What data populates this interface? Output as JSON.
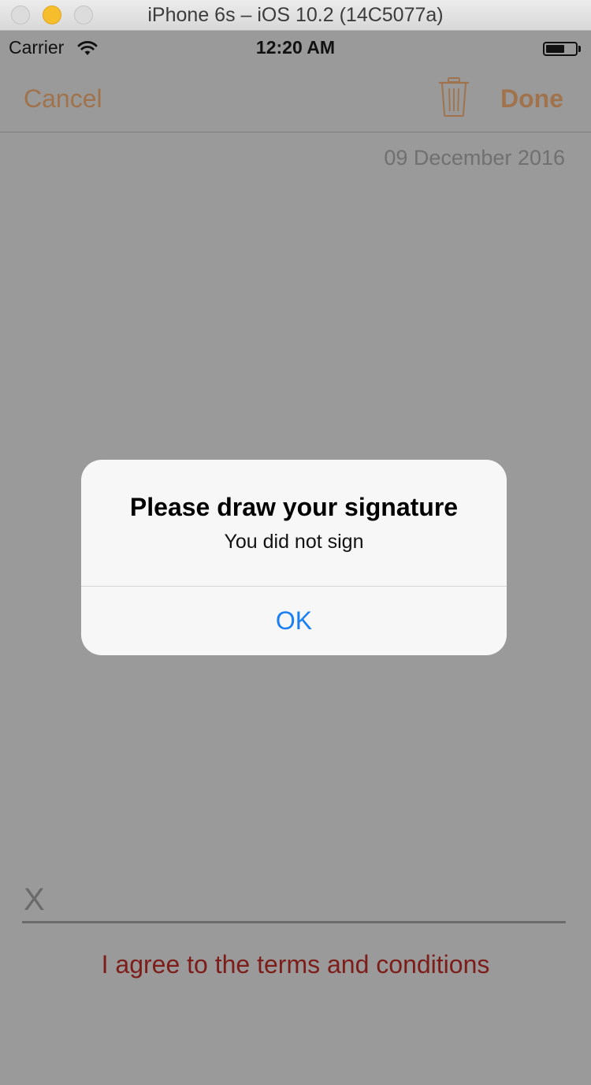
{
  "window": {
    "title": "iPhone 6s – iOS 10.2 (14C5077a)"
  },
  "status_bar": {
    "carrier": "Carrier",
    "time": "12:20 AM",
    "wifi_icon": "wifi-icon",
    "battery_icon": "battery-icon"
  },
  "nav": {
    "cancel_label": "Cancel",
    "trash_icon": "trash-icon",
    "done_label": "Done",
    "accent_color": "#a0734c"
  },
  "content": {
    "date": "09 December 2016",
    "signature_marker": "X",
    "terms_label": "I agree to the terms and conditions",
    "terms_color": "#7c1d1a"
  },
  "alert": {
    "title": "Please draw your signature",
    "message": "You did not sign",
    "ok_label": "OK",
    "ok_color": "#1a7ff2"
  }
}
